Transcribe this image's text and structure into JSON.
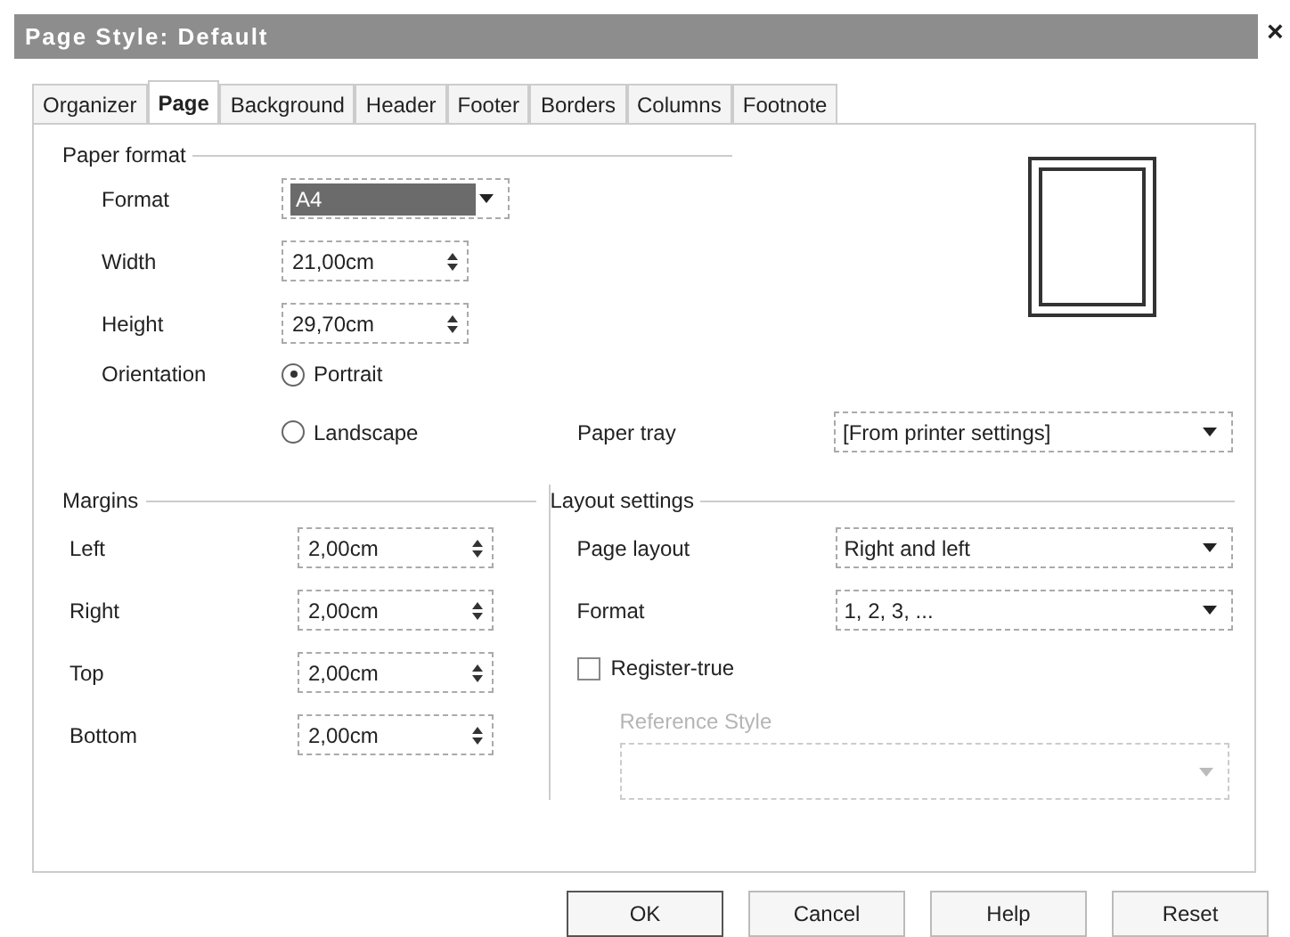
{
  "window": {
    "title": "Page Style: Default",
    "close": "×"
  },
  "tabs": [
    {
      "label": "Organizer",
      "selected": false
    },
    {
      "label": "Page",
      "selected": true
    },
    {
      "label": "Background",
      "selected": false
    },
    {
      "label": "Header",
      "selected": false
    },
    {
      "label": "Footer",
      "selected": false
    },
    {
      "label": "Borders",
      "selected": false
    },
    {
      "label": "Columns",
      "selected": false
    },
    {
      "label": "Footnote",
      "selected": false
    }
  ],
  "paper_format": {
    "title": "Paper format",
    "format": {
      "label": "Format",
      "value": "A4"
    },
    "width": {
      "label": "Width",
      "value": "21,00cm"
    },
    "height": {
      "label": "Height",
      "value": "29,70cm"
    },
    "orientation": {
      "label": "Orientation",
      "options": [
        {
          "label": "Portrait",
          "selected": true
        },
        {
          "label": "Landscape",
          "selected": false
        }
      ]
    },
    "paper_tray": {
      "label": "Paper tray",
      "value": "[From printer settings]"
    }
  },
  "margins": {
    "title": "Margins",
    "fields": [
      {
        "label": "Left",
        "value": "2,00cm"
      },
      {
        "label": "Right",
        "value": "2,00cm"
      },
      {
        "label": "Top",
        "value": "2,00cm"
      },
      {
        "label": "Bottom",
        "value": "2,00cm"
      }
    ]
  },
  "layout_settings": {
    "title": "Layout settings",
    "page_layout": {
      "label": "Page layout",
      "value": "Right and left"
    },
    "format": {
      "label": "Format",
      "value": "1, 2, 3, ..."
    },
    "register_true": {
      "label": "Register-true",
      "checked": false
    },
    "reference_style": {
      "label": "Reference Style",
      "disabled": true
    }
  },
  "buttons": [
    "OK",
    "Cancel",
    "Help",
    "Reset"
  ]
}
